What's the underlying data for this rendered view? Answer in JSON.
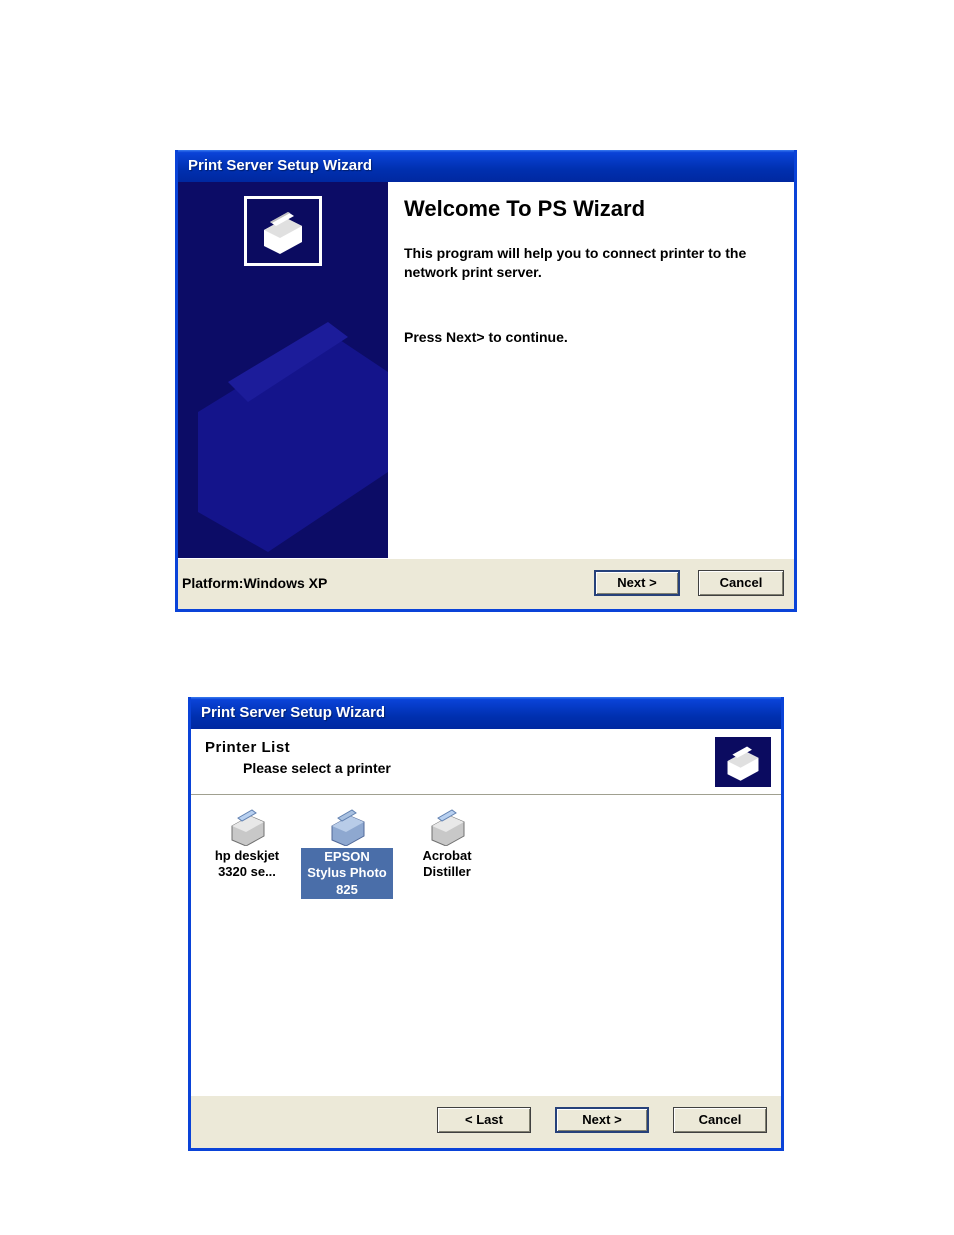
{
  "window1": {
    "title": "Print Server Setup Wizard",
    "heading": "Welcome To PS Wizard",
    "intro": "This program will help you to connect printer to the network print server.",
    "instruction": "Press Next> to continue.",
    "platform": "Platform:Windows XP",
    "buttons": {
      "next": "Next >",
      "cancel": "Cancel"
    }
  },
  "window2": {
    "title": "Print Server Setup Wizard",
    "list_title": "Printer   List",
    "list_subtitle": "Please select a printer",
    "printers": [
      {
        "label": "hp deskjet 3320 se...",
        "selected": false
      },
      {
        "label": "EPSON Stylus Photo 825",
        "selected": true
      },
      {
        "label": "Acrobat Distiller",
        "selected": false
      }
    ],
    "buttons": {
      "last": "< Last",
      "next": "Next >",
      "cancel": "Cancel"
    }
  }
}
